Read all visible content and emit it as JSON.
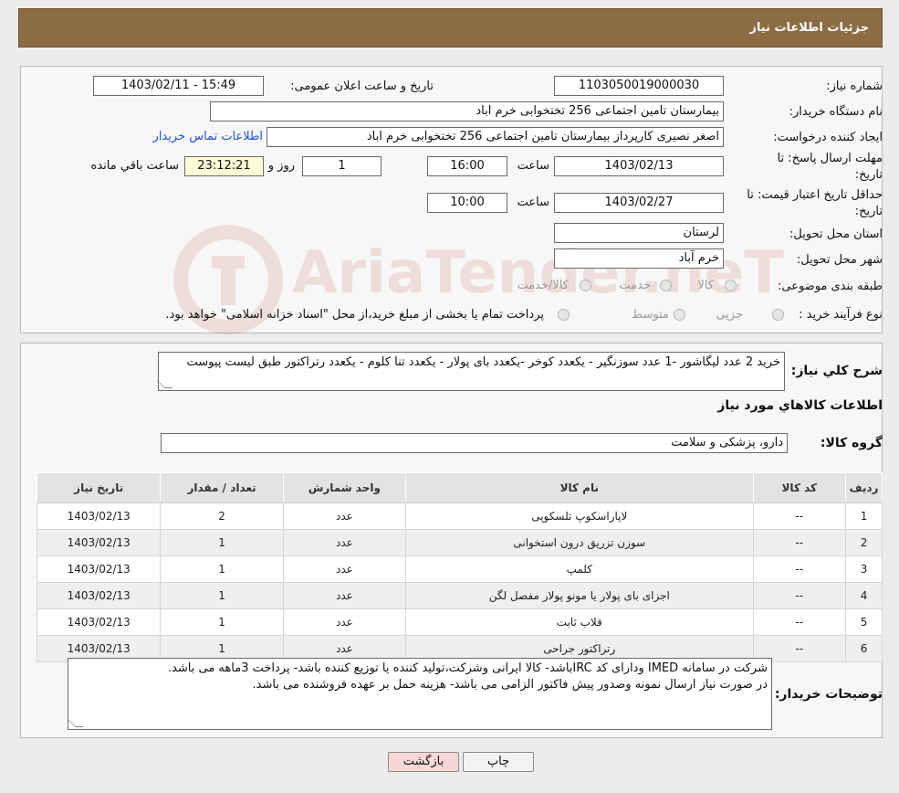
{
  "header": {
    "title": "جزئیات اطلاعات نیاز"
  },
  "form": {
    "need_number_label": "شماره نیاز:",
    "need_number": "1103050019000030",
    "announce_label": "تاریخ و ساعت اعلان عمومی:",
    "announce_value": "1403/02/11 - 15:49",
    "buyer_org_label": "نام دستگاه خریدار:",
    "buyer_org": "بیمارستان تامین اجتماعی  256 تختخوابی خرم اباد",
    "creator_label": "ایجاد کننده درخواست:",
    "creator": "اصغر نصیری کارپرداز بیمارستان تامین اجتماعی  256 تختخوابی خرم اباد",
    "contact_link": "اطلاعات تماس خریدار",
    "deadline_label_1": "مهلت ارسال پاسخ: تا",
    "deadline_label_2": "تاریخ:",
    "deadline_date": "1403/02/13",
    "time_label": "ساعت",
    "deadline_time": "16:00",
    "remaining_days": "1",
    "days_label": "روز و",
    "remaining_time": "23:12:21",
    "remaining_label": "ساعت باقي مانده",
    "validity_label_1": "حداقل تاریخ اعتبار قیمت: تا",
    "validity_label_2": "تاریخ:",
    "validity_date": "1403/02/27",
    "validity_time": "10:00",
    "province_label": "استان محل تحویل:",
    "province": "لرستان",
    "city_label": "شهر محل تحویل:",
    "city": "خرم آباد",
    "category_label": "طبقه بندی موضوعی:",
    "category_options": [
      "کالا",
      "خدمت",
      "کالا/خدمت"
    ],
    "purchase_type_label": "نوع فرآیند خرید :",
    "purchase_options": [
      "جزیی",
      "متوسط"
    ],
    "purchase_note": "پرداخت تمام یا بخشی از مبلغ خرید،از محل \"اسناد خزانه اسلامی\" خواهد بود."
  },
  "summary": {
    "label": "شرح کلي نياز:",
    "text": "خرید 2 عدد لیگاشور -1 عدد سوزنگیر - یکعدد کوخر -یکعدد بای پولار - یکعدد تنا کلوم - یکعدد رتراکتور طبق لیست پیوست",
    "goods_info_title": "اطلاعات کالاهاي مورد نياز",
    "goods_group_label": "گروه کالا:",
    "goods_group": "دارو، پزشکی و سلامت"
  },
  "table": {
    "headers": [
      "رديف",
      "کد کالا",
      "نام کالا",
      "واحد شمارش",
      "تعداد / مقدار",
      "تاریخ نیاز"
    ],
    "rows": [
      [
        "1",
        "--",
        "لاپاراسکوپ تلسکوپی",
        "عدد",
        "2",
        "1403/02/13"
      ],
      [
        "2",
        "--",
        "سوزن تزریق درون استخوانی",
        "عدد",
        "1",
        "1403/02/13"
      ],
      [
        "3",
        "--",
        "کلمپ",
        "عدد",
        "1",
        "1403/02/13"
      ],
      [
        "4",
        "--",
        "اجزای بای پولار یا مونو پولار مفصل لگن",
        "عدد",
        "1",
        "1403/02/13"
      ],
      [
        "5",
        "--",
        "قلاب ثابت",
        "عدد",
        "1",
        "1403/02/13"
      ],
      [
        "6",
        "--",
        "رتراکتور جراحی",
        "عدد",
        "1",
        "1403/02/13"
      ]
    ]
  },
  "buyer_notes": {
    "label": "توضیحات خریدار:",
    "line1": "شرکت در سامانه IMED ودارای کد IRCباشد- کالا ایرانی  وشرکت،تولید کننده یا توزیع کننده باشد- پرداخت 3ماهه می باشد.",
    "line2": "در صورت نیاز ارسال نمونه وصدور پیش فاکتور الزامی می باشد- هزینه حمل بر عهده فروشنده می باشد."
  },
  "buttons": {
    "print": "چاپ",
    "back": "بازگشت"
  },
  "watermark": {
    "text": "AriaTender.neT"
  }
}
